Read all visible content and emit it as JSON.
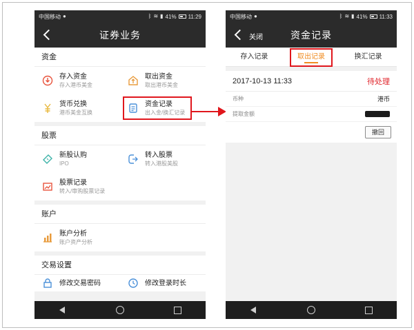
{
  "left_screen": {
    "statusbar": {
      "carrier": "中国移动",
      "battery": "41%",
      "time": "11:29"
    },
    "title": "证券业务",
    "sections": [
      {
        "title": "资金",
        "items": [
          {
            "name": "存入资金",
            "sub": "存入港币美金",
            "icon": "deposit-icon"
          },
          {
            "name": "取出资金",
            "sub": "取出港币美金",
            "icon": "withdraw-icon"
          },
          {
            "name": "货币兑换",
            "sub": "港币美金互换",
            "icon": "currency-exchange-icon"
          },
          {
            "name": "资金记录",
            "sub": "出入金/换汇记录",
            "icon": "fund-record-icon"
          }
        ]
      },
      {
        "title": "股票",
        "items": [
          {
            "name": "新股认购",
            "sub": "IPO",
            "icon": "ticket-icon"
          },
          {
            "name": "转入股票",
            "sub": "转入港股美股",
            "icon": "transfer-in-icon"
          },
          {
            "name": "股票记录",
            "sub": "转入/审购股票记录",
            "icon": "stock-record-icon"
          }
        ]
      },
      {
        "title": "账户",
        "items": [
          {
            "name": "账户分析",
            "sub": "账户资产分析",
            "icon": "analysis-chart-icon"
          }
        ]
      },
      {
        "title": "交易设置",
        "items": [
          {
            "name": "修改交易密码",
            "sub": "",
            "icon": "lock-icon"
          },
          {
            "name": "修改登录时长",
            "sub": "",
            "icon": "clock-icon"
          }
        ]
      }
    ]
  },
  "right_screen": {
    "statusbar": {
      "carrier": "中国移动",
      "battery": "41%",
      "time": "11:33"
    },
    "close_label": "关闭",
    "title": "资金记录",
    "tabs": [
      {
        "label": "存入记录",
        "active": false
      },
      {
        "label": "取出记录",
        "active": true
      },
      {
        "label": "换汇记录",
        "active": false
      }
    ],
    "record": {
      "datetime": "2017-10-13 11:33",
      "status": "待处理",
      "currency_label": "币种",
      "currency_value": "港币",
      "amount_label": "提取金额",
      "withdraw_button": "撤回"
    }
  },
  "colors": {
    "accent": "#f08c21",
    "status_red": "#e0262c",
    "highlight_red": "#e0161c",
    "bar_dark": "#2b2b2b"
  }
}
